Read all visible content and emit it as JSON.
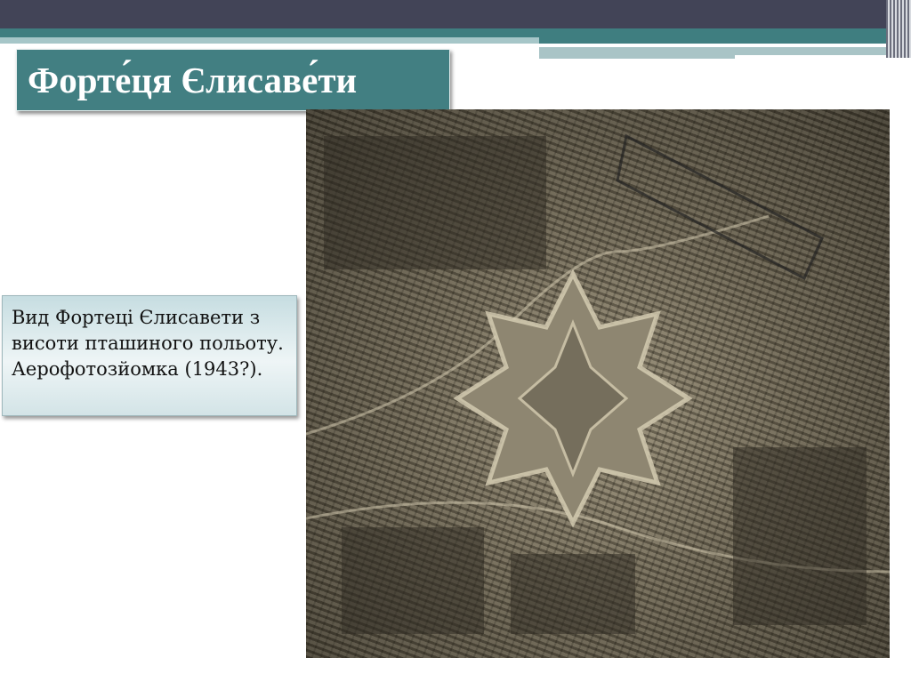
{
  "slide": {
    "title": "Форте́ця Єлисаве́ти",
    "caption": "Вид Фортеці Єлисавети з висоти пташиного польоту. Аерофотозйомка (1943?).",
    "photo_label": "aerial-photo-fortress"
  },
  "colors": {
    "header_dark": "#424457",
    "accent_teal": "#427f82"
  }
}
